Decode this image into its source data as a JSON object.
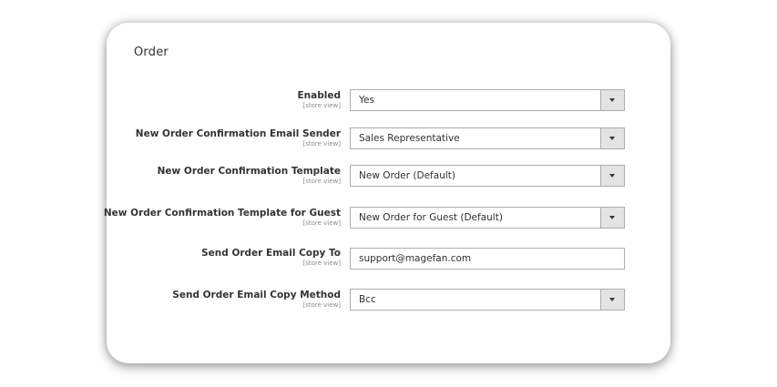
{
  "section": {
    "title": "Order"
  },
  "fields": [
    {
      "label": "Enabled",
      "scope": "[store view]",
      "value": "Yes",
      "type": "select"
    },
    {
      "label": "New Order Confirmation Email Sender",
      "scope": "[store view]",
      "value": "Sales Representative",
      "type": "select"
    },
    {
      "label": "New Order Confirmation Template",
      "scope": "[store view]",
      "value": "New Order (Default)",
      "type": "select"
    },
    {
      "label": "New Order Confirmation Template for Guest",
      "scope": "[store view]",
      "value": "New Order for Guest (Default)",
      "type": "select"
    },
    {
      "label": "Send Order Email Copy To",
      "scope": "[store view]",
      "value": "support@magefan.com",
      "type": "text"
    },
    {
      "label": "Send Order Email Copy Method",
      "scope": "[store view]",
      "value": "Bcc",
      "type": "select"
    }
  ],
  "icons": {
    "select_toggle": "chevron-down-icon"
  },
  "colors": {
    "border": "#adadad",
    "toggle_bg": "#e3e3e3",
    "text": "#303030",
    "scope_text": "#8c8c8c"
  }
}
